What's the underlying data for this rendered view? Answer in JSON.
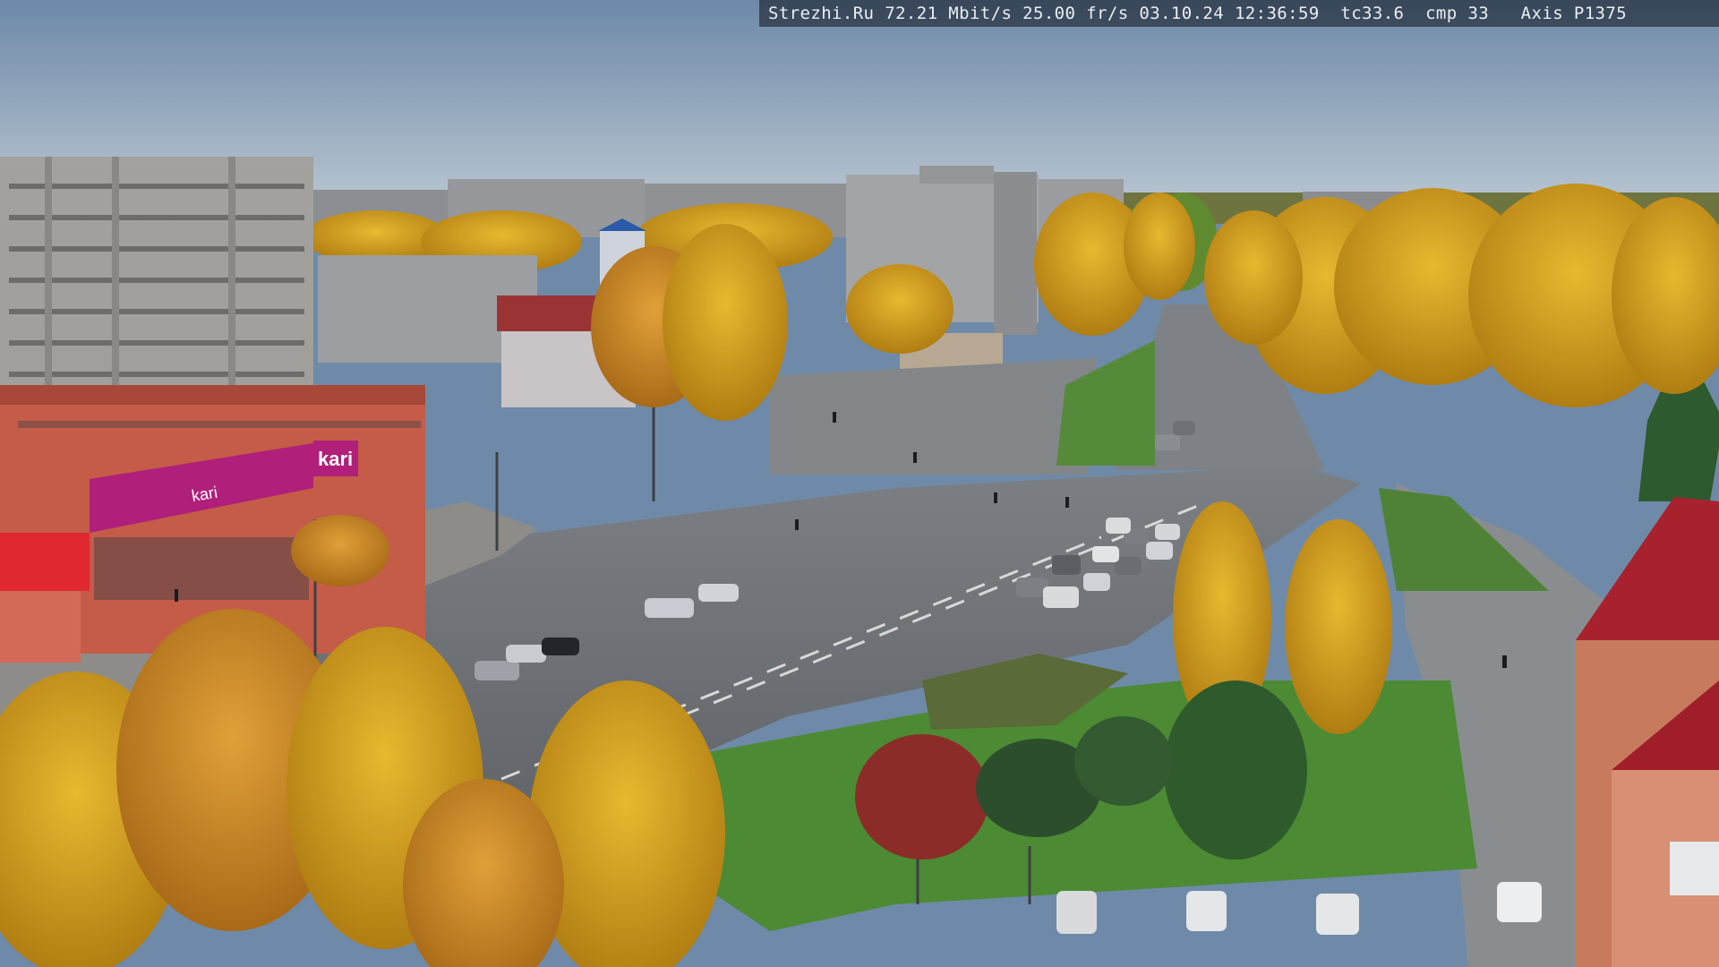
{
  "overlay": {
    "site": "Strezhi.Ru",
    "bitrate": "72.21 Mbit/s",
    "framerate": "25.00 fr/s",
    "date": "03.10.24",
    "time": "12:36:59",
    "tc": "tc33.6",
    "cmp": "cmp 33",
    "camera": "Axis P1375"
  },
  "signage": {
    "store_logo": "kari",
    "facade_text": "kari",
    "facade_text_lower": "kari"
  },
  "colors": {
    "sky_top": "#6f8aa8",
    "sky_bottom": "#b9c6d2",
    "asphalt": "#64686c",
    "grass": "#4f8a36",
    "foliage_yellow": "#d4a020",
    "store_magenta": "#b0207a"
  }
}
